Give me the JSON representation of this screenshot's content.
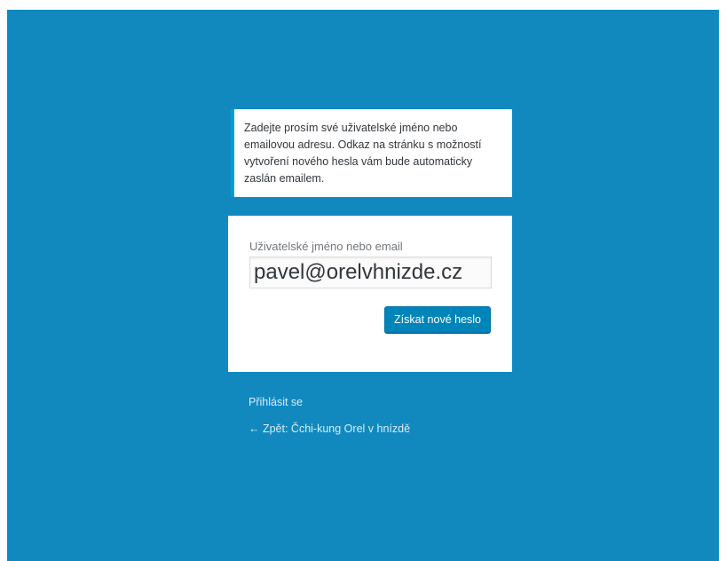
{
  "message": {
    "text": "Zadejte prosím své uživatelské jméno nebo emailovou adresu. Odkaz na stránku s možností vytvoření nového hesla vám bude automaticky zaslán emailem."
  },
  "form": {
    "label": "Uživatelské jméno nebo email",
    "input_value": "pavel@orelvhnizde.cz",
    "submit_label": "Získat nové heslo"
  },
  "nav": {
    "login_label": "Přihlásit se",
    "back_label": "← Zpět: Čchi-kung Orel v hnízdě"
  },
  "colors": {
    "background": "#1189bf",
    "primary_button": "#0085ba",
    "message_accent": "#00a0d2"
  }
}
